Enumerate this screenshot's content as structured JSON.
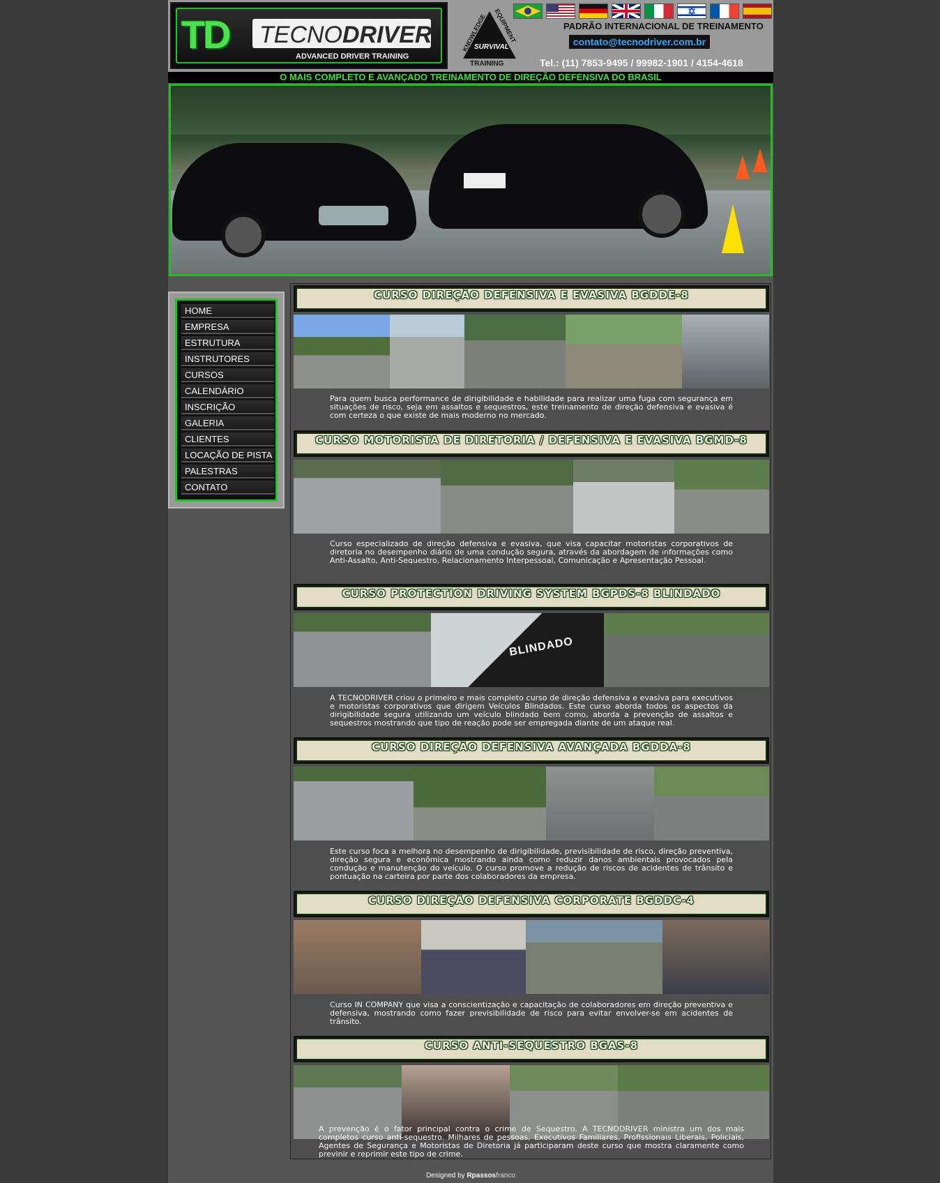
{
  "header": {
    "logo_letters": "TD",
    "logo_name_part1": "TECNO",
    "logo_name_part2": "DRIVER",
    "logo_subtitle": "ADVANCED DRIVER TRAINING",
    "triangle_labels": [
      "KNOWLEDGE",
      "EQUIPMENT",
      "SURVIVAL",
      "TRAINING"
    ],
    "standard": "PADRÃO INTERNACIONAL DE TREINAMENTO",
    "email": "contato@tecnodriver.com.br",
    "phone": "Tel.: (11) 7853-9495 / 99982-1901 / 4154-4618",
    "flags": [
      "brazil-flag",
      "usa-flag",
      "germany-flag",
      "uk-flag",
      "italy-flag",
      "israel-flag",
      "france-flag",
      "spain-flag"
    ]
  },
  "tagline": "O MAIS COMPLETO E AVANÇADO TREINAMENTO DE DIREÇÃO DEFENSIVA DO BRASIL",
  "menu": [
    "HOME",
    "EMPRESA",
    "ESTRUTURA",
    "INSTRUTORES",
    "CURSOS",
    "CALENDÁRIO",
    "INSCRIÇÃO",
    "GALERIA",
    "CLIENTES",
    "LOCAÇÃO DE PISTA",
    "PALESTRAS",
    "CONTATO"
  ],
  "courses": [
    {
      "title": "CURSO DIREÇÃO DEFENSIVA E EVASIVA    BGDDE-8",
      "text": "Para quem busca performance de dirigibilidade e habilidade para realizar uma fuga com segurança em situações de risco, seja em assaltos e sequestros, este treinamento de direção defensiva e evasiva é com certeza o que existe de mais moderno no mercado."
    },
    {
      "title": "CURSO MOTORISTA DE DIRETORIA / DEFENSIVA E EVASIVA   BGMD-8",
      "text": "Curso especializado de direção defensiva e evasiva, que visa capacitar motoristas corporativos de diretoria no desempenho diário de uma condução segura, através da abordagem de informações como Anti-Assalto, Anti-Sequestro, Relacionamento Interpessoal, Comunicação e Apresentação Pessoal."
    },
    {
      "title": "CURSO PROTECTION DRIVING SYSTEM    BGPDS-8    BLINDADO",
      "text": "A TECNODRIVER criou o primeiro e mais completo curso de direção defensiva e evasiva para executivos e motoristas corporativos que dirigem Veículos Blindados. Este curso aborda todos os aspectos da dirigibilidade segura utilizando um veículo blindado bem como, aborda a prevenção de assaltos e sequestros mostrando que tipo de reação pode ser empregada diante de um ataque real."
    },
    {
      "title": "CURSO DIREÇÃO DEFENSIVA  AVANÇADA    BGDDA-8",
      "text": "Este curso foca a melhora no desempenho de dirigibilidade, previsibilidade de risco, direção preventiva, direção segura e econômica mostrando ainda como reduzir danos ambientais provocados pela condução e manutenção do veículo. O curso promove a redução de riscos de acidentes de trânsito e pontuação na carteira por parte dos colaboradores da empresa."
    },
    {
      "title": "CURSO DIREÇÃO DEFENSIVA CORPORATE    BGDDC-4",
      "text": "Curso IN COMPANY que visa a conscientização e capacitação de colaboradores em direção preventiva e defensiva, mostrando como fazer previsibilidade de risco para evitar envolver-se em acidentes de trânsito."
    },
    {
      "title": "CURSO ANTI-SEQUESTRO   BGAS-8",
      "text": "A prevenção é o fator principal contra o crime de Sequestro. A TECNODRIVER ministra um dos mais completos curso anti-sequestro. Milhares de pessoas, Executivos Familiares, Profissionais Liberais, Policiais, Agentes de Segurança e Motoristas de Diretoria já participaram deste curso que mostra claramente como previnir e reprimir este tipo de crime."
    }
  ],
  "photo_labels": {
    "blindado": "BLINDADO"
  },
  "footer": {
    "prefix": "Designed by ",
    "author_bold": "Rpassos",
    "author_rest": "franco"
  },
  "colors": {
    "accent_green": "#22c222",
    "tagline_green": "#3be03b",
    "email_blue": "#2ea7ff",
    "page_bg": "#555555",
    "outer_bg": "#3a3a3a"
  }
}
